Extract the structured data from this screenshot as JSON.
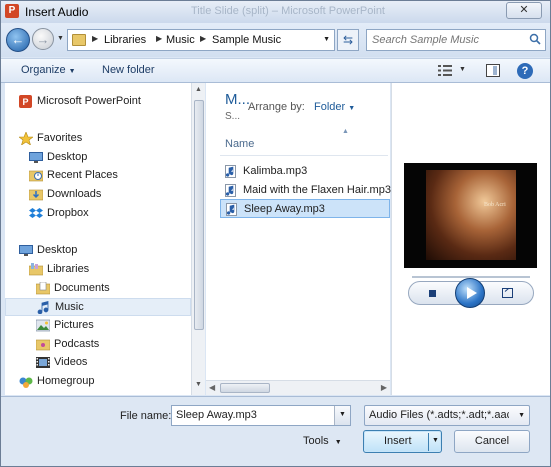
{
  "window": {
    "title": "Insert Audio",
    "background_title": "Title Slide (split) – Microsoft PowerPoint",
    "close_glyph": "✕"
  },
  "address": {
    "crumbs": [
      "Libraries",
      "Music",
      "Sample Music"
    ],
    "search_placeholder": "Search Sample Music"
  },
  "toolbar": {
    "organize_label": "Organize",
    "new_folder_label": "New folder"
  },
  "nav": {
    "items": [
      {
        "label": "Microsoft PowerPoint",
        "icon": "powerpoint-icon"
      },
      {
        "label": "Favorites",
        "icon": "star-icon"
      },
      {
        "label": "Desktop",
        "icon": "desktop-icon"
      },
      {
        "label": "Recent Places",
        "icon": "recent-places-icon"
      },
      {
        "label": "Downloads",
        "icon": "downloads-icon"
      },
      {
        "label": "Dropbox",
        "icon": "dropbox-icon"
      },
      {
        "label": "Desktop",
        "icon": "desktop-icon"
      },
      {
        "label": "Libraries",
        "icon": "libraries-icon"
      },
      {
        "label": "Documents",
        "icon": "documents-icon"
      },
      {
        "label": "Music",
        "icon": "music-icon",
        "selected": true
      },
      {
        "label": "Pictures",
        "icon": "pictures-icon"
      },
      {
        "label": "Podcasts",
        "icon": "podcasts-icon"
      },
      {
        "label": "Videos",
        "icon": "videos-icon"
      },
      {
        "label": "Homegroup",
        "icon": "homegroup-icon"
      }
    ]
  },
  "files": {
    "library_title": "M...",
    "library_sub": "S...",
    "arrange_label": "Arrange by:",
    "arrange_value": "Folder",
    "column_name": "Name",
    "items": [
      {
        "name": "Kalimba.mp3"
      },
      {
        "name": "Maid with the Flaxen Hair.mp3"
      },
      {
        "name": "Sleep Away.mp3",
        "selected": true
      }
    ]
  },
  "preview": {
    "album_caption": "Bob Acri"
  },
  "bottom": {
    "file_name_label": "File name:",
    "file_name_value": "Sleep Away.mp3",
    "file_type_value": "Audio Files (*.adts;*.adt;*.aac;*.",
    "tools_label": "Tools",
    "insert_label": "Insert",
    "cancel_label": "Cancel"
  },
  "colors": {
    "accent": "#1e5b99",
    "selection": "#cce3f9",
    "window_frame": "#dbe6f4"
  }
}
